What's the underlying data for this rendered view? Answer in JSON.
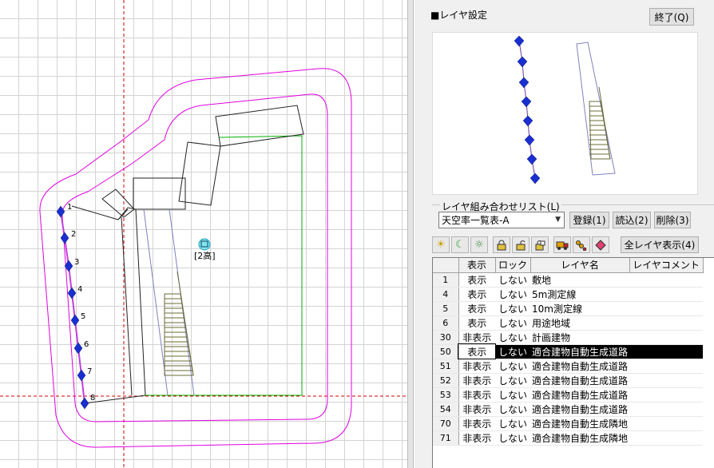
{
  "canvas": {
    "label_2f": "[2高]",
    "point_numbers": [
      "1",
      "2",
      "3",
      "4",
      "5",
      "6",
      "7",
      "8"
    ],
    "colors": {
      "boundary": "#e000e0",
      "red_guide": "#d00000",
      "green_line": "#00b000",
      "point": "#1a2fd0"
    }
  },
  "panel": {
    "title": "■レイヤ設定",
    "close_label": "終了(Q)",
    "combo_label": "レイヤ組み合わせリスト(L)",
    "combo_value": "天空率一覧表-A",
    "register_label": "登録(1)",
    "load_label": "読込(2)",
    "delete_label": "削除(3)",
    "show_all_label": "全レイヤ表示(4)",
    "tool_icons": [
      "sun-icon",
      "moon-icon",
      "sun-moon-icon",
      "lock-icon",
      "unlock-icon",
      "lock-toggle-icon",
      "truck-icon",
      "chain-icon",
      "diamond-icon"
    ]
  },
  "table": {
    "headers": [
      "表示",
      "ロック",
      "レイヤ名",
      "レイヤコメント"
    ],
    "rows": [
      {
        "num": "1",
        "vis": "表示",
        "lock": "しない",
        "name": "敷地",
        "comment": ""
      },
      {
        "num": "4",
        "vis": "表示",
        "lock": "しない",
        "name": "5m測定線",
        "comment": ""
      },
      {
        "num": "5",
        "vis": "表示",
        "lock": "しない",
        "name": "10m測定線",
        "comment": ""
      },
      {
        "num": "6",
        "vis": "表示",
        "lock": "しない",
        "name": "用途地域",
        "comment": ""
      },
      {
        "num": "30",
        "vis": "非表示",
        "lock": "しない",
        "name": "計画建物",
        "comment": ""
      },
      {
        "num": "50",
        "vis": "表示",
        "lock": "しない",
        "name": "適合建物自動生成道路",
        "comment": "",
        "selected": true
      },
      {
        "num": "51",
        "vis": "非表示",
        "lock": "しない",
        "name": "適合建物自動生成道路",
        "comment": ""
      },
      {
        "num": "52",
        "vis": "非表示",
        "lock": "しない",
        "name": "適合建物自動生成道路",
        "comment": ""
      },
      {
        "num": "53",
        "vis": "非表示",
        "lock": "しない",
        "name": "適合建物自動生成道路",
        "comment": ""
      },
      {
        "num": "54",
        "vis": "非表示",
        "lock": "しない",
        "name": "適合建物自動生成道路",
        "comment": ""
      },
      {
        "num": "70",
        "vis": "非表示",
        "lock": "しない",
        "name": "適合建物自動生成隣地",
        "comment": ""
      },
      {
        "num": "71",
        "vis": "非表示",
        "lock": "しない",
        "name": "適合建物自動生成隣地",
        "comment": ""
      }
    ]
  }
}
